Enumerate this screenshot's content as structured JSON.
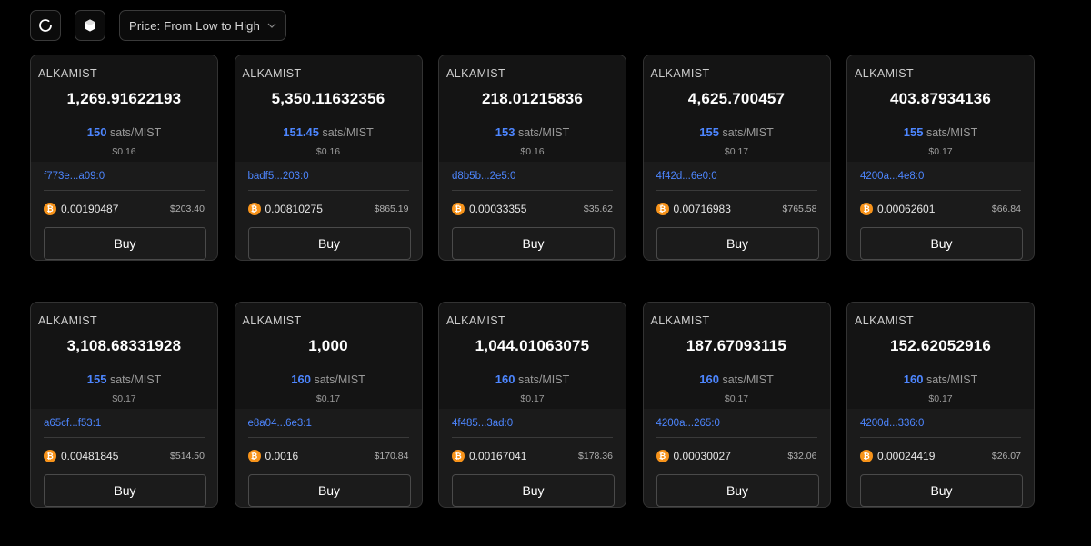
{
  "toolbar": {
    "refresh_icon": "refresh-icon",
    "token_icon": "hexagon-icon",
    "sort": {
      "selected": "Price: From Low to High"
    }
  },
  "colors": {
    "background": "#000000",
    "card": "#1b1b1b",
    "card_top": "#141414",
    "accent": "#4d86ff",
    "btc": "#f7931a"
  },
  "buy_label": "Buy",
  "unit_label": "sats/MIST",
  "listings": [
    {
      "ticker": "ALKAMIST",
      "amount": "1,269.91622193",
      "rate": "150",
      "usd_unit": "$0.16",
      "inscription": "f773e...a09:0",
      "btc": "0.00190487",
      "usd_total": "$203.40"
    },
    {
      "ticker": "ALKAMIST",
      "amount": "5,350.11632356",
      "rate": "151.45",
      "usd_unit": "$0.16",
      "inscription": "badf5...203:0",
      "btc": "0.00810275",
      "usd_total": "$865.19"
    },
    {
      "ticker": "ALKAMIST",
      "amount": "218.01215836",
      "rate": "153",
      "usd_unit": "$0.16",
      "inscription": "d8b5b...2e5:0",
      "btc": "0.00033355",
      "usd_total": "$35.62"
    },
    {
      "ticker": "ALKAMIST",
      "amount": "4,625.700457",
      "rate": "155",
      "usd_unit": "$0.17",
      "inscription": "4f42d...6e0:0",
      "btc": "0.00716983",
      "usd_total": "$765.58"
    },
    {
      "ticker": "ALKAMIST",
      "amount": "403.87934136",
      "rate": "155",
      "usd_unit": "$0.17",
      "inscription": "4200a...4e8:0",
      "btc": "0.00062601",
      "usd_total": "$66.84"
    },
    {
      "ticker": "ALKAMIST",
      "amount": "3,108.68331928",
      "rate": "155",
      "usd_unit": "$0.17",
      "inscription": "a65cf...f53:1",
      "btc": "0.00481845",
      "usd_total": "$514.50"
    },
    {
      "ticker": "ALKAMIST",
      "amount": "1,000",
      "rate": "160",
      "usd_unit": "$0.17",
      "inscription": "e8a04...6e3:1",
      "btc": "0.0016",
      "usd_total": "$170.84"
    },
    {
      "ticker": "ALKAMIST",
      "amount": "1,044.01063075",
      "rate": "160",
      "usd_unit": "$0.17",
      "inscription": "4f485...3ad:0",
      "btc": "0.00167041",
      "usd_total": "$178.36"
    },
    {
      "ticker": "ALKAMIST",
      "amount": "187.67093115",
      "rate": "160",
      "usd_unit": "$0.17",
      "inscription": "4200a...265:0",
      "btc": "0.00030027",
      "usd_total": "$32.06"
    },
    {
      "ticker": "ALKAMIST",
      "amount": "152.62052916",
      "rate": "160",
      "usd_unit": "$0.17",
      "inscription": "4200d...336:0",
      "btc": "0.00024419",
      "usd_total": "$26.07"
    }
  ]
}
